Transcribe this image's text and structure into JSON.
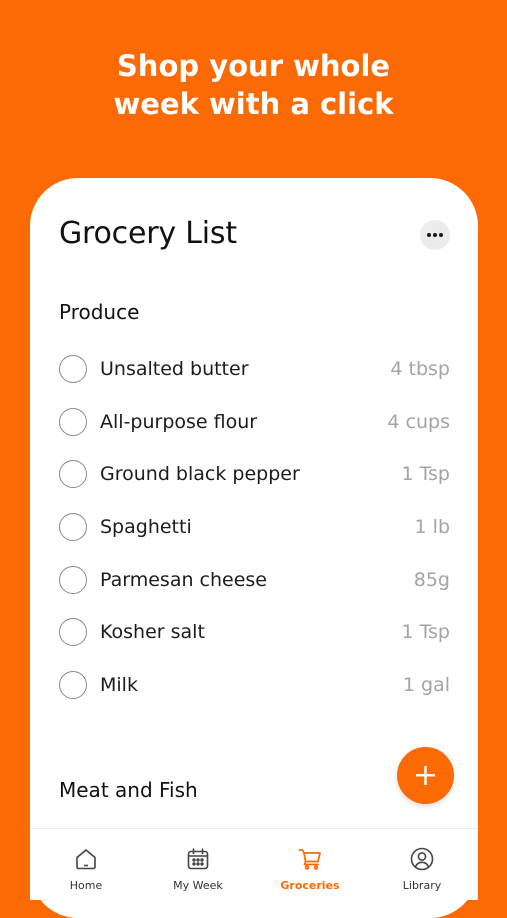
{
  "headline": "Shop your whole\nweek with a click",
  "card": {
    "title": "Grocery List",
    "more_icon": "more-horizontal-icon"
  },
  "sections": [
    {
      "title": "Produce",
      "items": [
        {
          "name": "Unsalted butter",
          "qty": "4 tbsp"
        },
        {
          "name": "All-purpose flour",
          "qty": "4 cups"
        },
        {
          "name": "Ground black pepper",
          "qty": "1 Tsp"
        },
        {
          "name": "Spaghetti",
          "qty": "1 lb"
        },
        {
          "name": "Parmesan cheese",
          "qty": "85g"
        },
        {
          "name": "Kosher salt",
          "qty": "1 Tsp"
        },
        {
          "name": "Milk",
          "qty": "1 gal"
        }
      ]
    },
    {
      "title": "Meat and Fish",
      "items": []
    }
  ],
  "fab": {
    "label": "+",
    "icon": "plus-icon"
  },
  "tabbar": {
    "tabs": [
      {
        "label": "Home",
        "icon": "home-icon",
        "active": false
      },
      {
        "label": "My Week",
        "icon": "calendar-icon",
        "active": false
      },
      {
        "label": "Groceries",
        "icon": "cart-icon",
        "active": true
      },
      {
        "label": "Library",
        "icon": "user-circle-icon",
        "active": false
      }
    ]
  },
  "colors": {
    "accent": "#fb6a04",
    "card_bg": "#ffffff",
    "text": "#111111",
    "muted": "#a4a4a4"
  }
}
